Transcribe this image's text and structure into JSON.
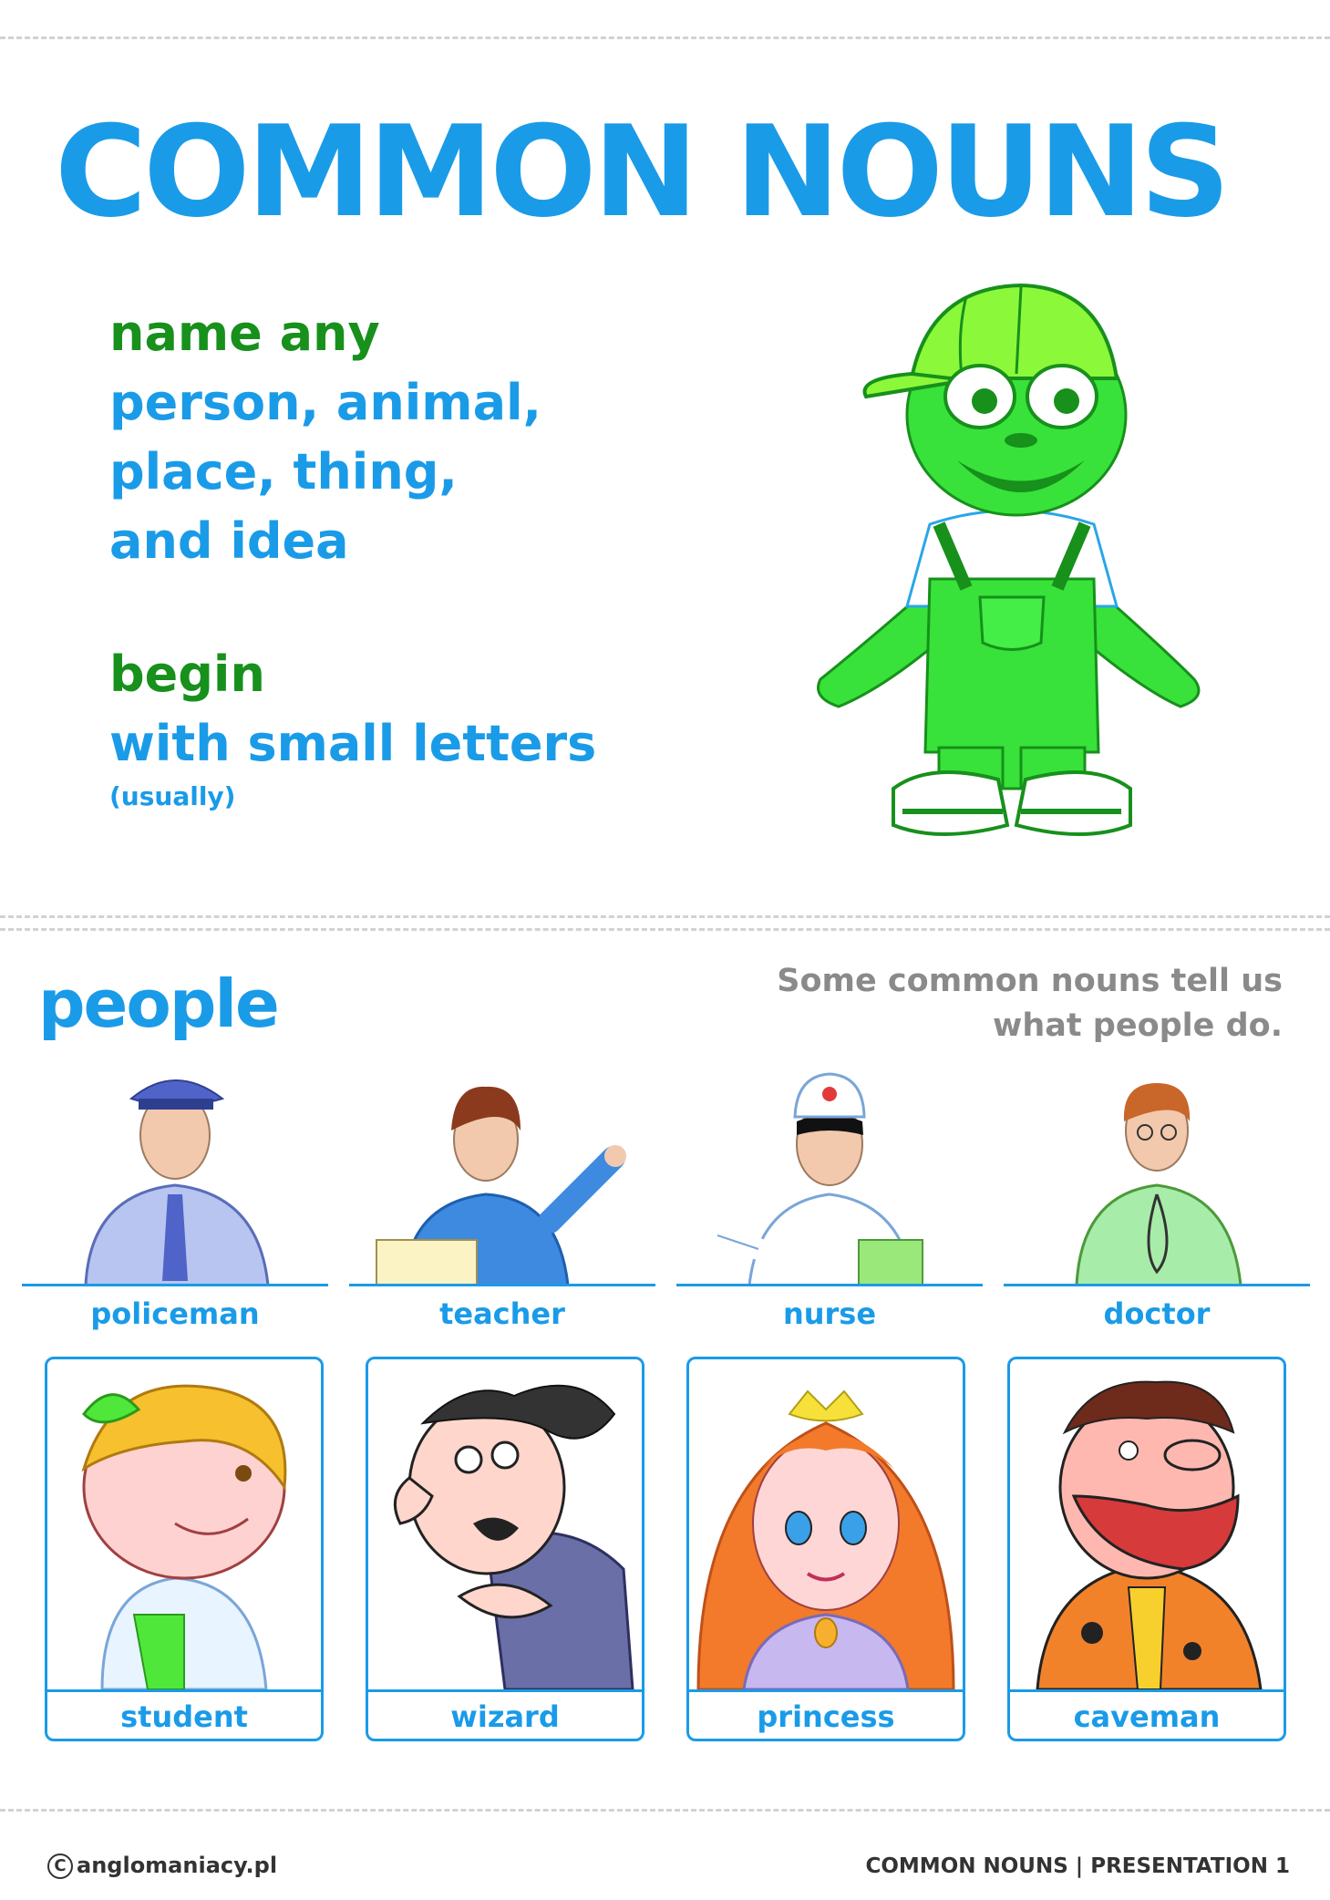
{
  "title": "COMMON NOUNS",
  "rules": {
    "r1_head": "name any",
    "r1_l1": "person, animal,",
    "r1_l2": "place, thing,",
    "r1_l3": "and idea",
    "r2_head": "begin",
    "r2_l1": "with small letters",
    "r2_note": "(usually)"
  },
  "section": {
    "title": "people",
    "note_l1": "Some common nouns tell us",
    "note_l2": "what people do."
  },
  "jobs": [
    "policeman",
    "teacher",
    "nurse",
    "doctor"
  ],
  "cards": [
    "student",
    "wizard",
    "princess",
    "caveman"
  ],
  "footer": {
    "copyright_symbol": "C",
    "copyright_text": "anglomaniacy.pl",
    "right": "COMMON NOUNS  |  PRESENTATION 1"
  },
  "colors": {
    "blue": "#1a9be8",
    "green": "#17901c",
    "grey": "#8a8a8a"
  }
}
